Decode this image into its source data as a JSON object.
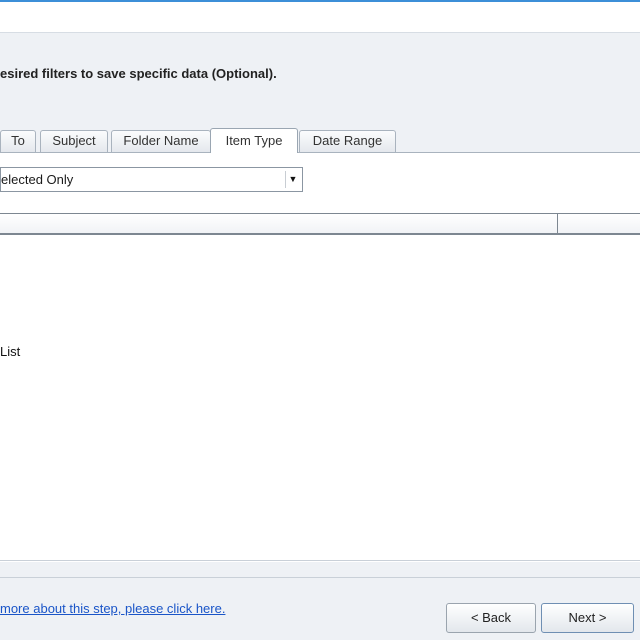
{
  "instruction": "esired filters to save specific data (Optional).",
  "tabs": [
    {
      "label": "To"
    },
    {
      "label": "Subject"
    },
    {
      "label": "Folder Name"
    },
    {
      "label": "Item Type"
    },
    {
      "label": "Date Range"
    }
  ],
  "active_tab": "Item Type",
  "filter_select": {
    "value": "elected Only"
  },
  "list": {
    "items": [
      "List"
    ]
  },
  "help_link": "more about this step, please click here.",
  "buttons": {
    "back": "< Back",
    "next": "Next >"
  },
  "colors": {
    "accent": "#3c8fd8",
    "link": "#1a55c8"
  }
}
